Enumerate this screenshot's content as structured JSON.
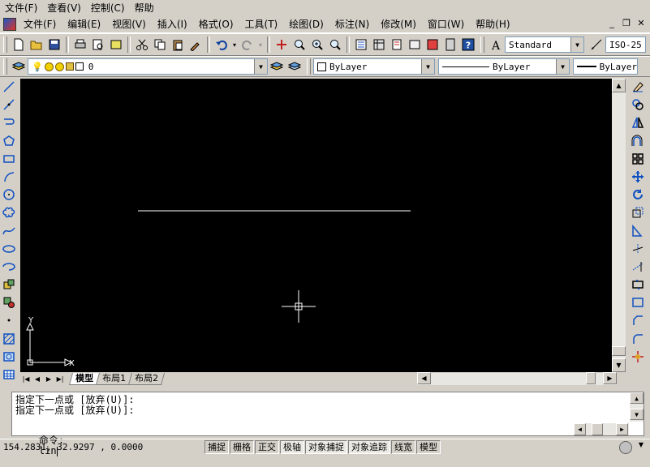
{
  "outer_menu": [
    "文件(F)",
    "查看(V)",
    "控制(C)",
    "帮助"
  ],
  "doc_menu": [
    "文件(F)",
    "编辑(E)",
    "视图(V)",
    "插入(I)",
    "格式(O)",
    "工具(T)",
    "绘图(D)",
    "标注(N)",
    "修改(M)",
    "窗口(W)",
    "帮助(H)"
  ],
  "window_buttons": [
    "_",
    "❐",
    "✕"
  ],
  "toolbar": {
    "text_style": "Standard",
    "dim_style": "ISO-25"
  },
  "layers": {
    "current_layer": "0",
    "color": "ByLayer",
    "linetype": "ByLayer",
    "lineweight": "ByLayer"
  },
  "ucs": {
    "x_label": "X",
    "y_label": "Y"
  },
  "layout_tabs": [
    "模型",
    "布局1",
    "布局2"
  ],
  "command_window": {
    "history": [
      "指定下一点或 [放弃(U)]:",
      "指定下一点或 [放弃(U)]:"
    ],
    "prompt": "命令:",
    "input": "lin"
  },
  "status": {
    "coordinates": "154.2831, 32.9297 , 0.0000",
    "toggles": [
      "捕捉",
      "栅格",
      "正交",
      "极轴",
      "对象捕捉",
      "对象追踪",
      "线宽",
      "模型"
    ],
    "active_toggles": [
      "极轴",
      "对象捕捉",
      "对象追踪"
    ]
  },
  "colors": {
    "canvas": "#000000",
    "chrome": "#d4d0c8"
  }
}
